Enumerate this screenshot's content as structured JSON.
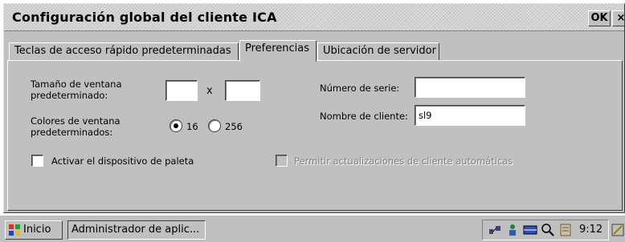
{
  "window": {
    "title": "Configuración global del cliente ICA",
    "ok_label": "OK",
    "close_label": "×"
  },
  "tabs": [
    {
      "label": "Teclas de acceso rápido predeterminadas"
    },
    {
      "label": "Preferencias"
    },
    {
      "label": "Ubicación de servidor"
    }
  ],
  "form": {
    "window_size_label_line1": "Tamaño de ventana",
    "window_size_label_line2": "predeterminado:",
    "width_value": "",
    "size_separator": "x",
    "height_value": "",
    "colors_label_line1": "Colores de ventana",
    "colors_label_line2": "predeterminados:",
    "color_options": [
      {
        "label": "16",
        "selected": true
      },
      {
        "label": "256",
        "selected": false
      }
    ],
    "serial_label": "Número de serie:",
    "serial_value": "",
    "client_name_label": "Nombre de cliente:",
    "client_name_value": "sl9",
    "palette_checkbox_label": "Activar el dispositivo de paleta",
    "palette_checked": false,
    "auto_update_label": "Permitir actualizaciones de cliente automáticas",
    "auto_update_checked": false,
    "auto_update_enabled": false
  },
  "taskbar": {
    "start_label": "Inicio",
    "task_label": "Administrador de aplic...",
    "clock": "9:12",
    "tray_icons": [
      "network-icon",
      "user-icon",
      "keyboard-icon",
      "search-icon",
      "input-method-icon"
    ]
  },
  "colors": {
    "face": "#c0c0c0",
    "highlight": "#ffffff",
    "shadow": "#404040"
  }
}
